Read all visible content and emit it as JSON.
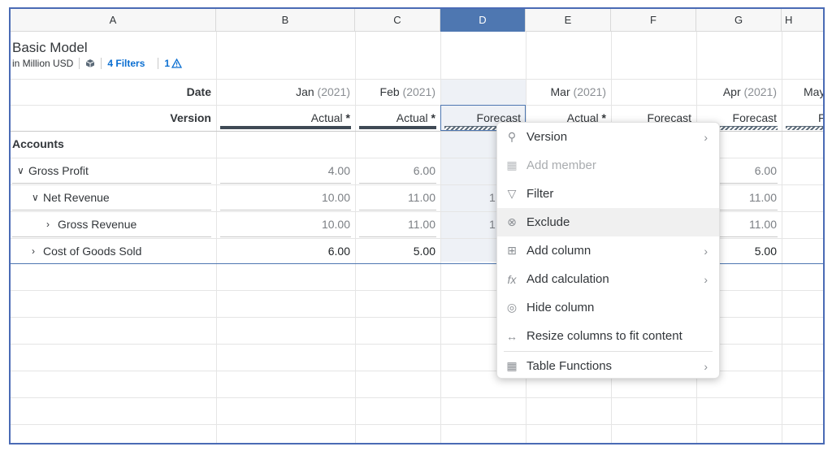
{
  "columns": [
    {
      "letter": "A"
    },
    {
      "letter": "B"
    },
    {
      "letter": "C"
    },
    {
      "letter": "D"
    },
    {
      "letter": "E"
    },
    {
      "letter": "F"
    },
    {
      "letter": "G"
    },
    {
      "letter": "H"
    }
  ],
  "header": {
    "title": "Basic Model",
    "unit": "in Million USD",
    "filters": "4 Filters",
    "warnings": "1"
  },
  "rows": {
    "date_label": "Date",
    "version_label": "Version",
    "accounts_label": "Accounts"
  },
  "dates": [
    {
      "month": "Jan",
      "year": "(2021)"
    },
    {
      "month": "Feb",
      "year": "(2021)"
    },
    {
      "month": "Mar",
      "year": "(2021)"
    },
    {
      "month": "Apr",
      "year": "(2021)"
    },
    {
      "month": "May",
      "year": ""
    }
  ],
  "versions": {
    "b": "Actual",
    "c": "Actual",
    "d": "Forecast",
    "e": "Actual",
    "f": "Forecast",
    "g": "Forecast",
    "h": "F",
    "star": "*"
  },
  "accounts": [
    {
      "label": "Gross Profit",
      "chev": "∨",
      "b": "4.00",
      "c": "6.00",
      "d": "",
      "g": "6.00"
    },
    {
      "label": "Net Revenue",
      "chev": "∨",
      "b": "10.00",
      "c": "11.00",
      "d": "1",
      "g": "11.00"
    },
    {
      "label": "Gross Revenue",
      "chev": "›",
      "b": "10.00",
      "c": "11.00",
      "d": "1",
      "g": "11.00"
    },
    {
      "label": "Cost of Goods Sold",
      "chev": "›",
      "b": "6.00",
      "c": "5.00",
      "d": "",
      "g": "5.00"
    }
  ],
  "menu": {
    "items": [
      {
        "label": "Version",
        "icon": "⚲"
      },
      {
        "label": "Add member",
        "icon": "▦"
      },
      {
        "label": "Filter",
        "icon": "▽"
      },
      {
        "label": "Exclude",
        "icon": "⊗"
      },
      {
        "label": "Add column",
        "icon": "⊞"
      },
      {
        "label": "Add calculation",
        "icon": "fx"
      },
      {
        "label": "Hide column",
        "icon": "◎"
      },
      {
        "label": "Resize columns to fit content",
        "icon": "↔"
      },
      {
        "label": "Table Functions",
        "icon": "▦"
      }
    ],
    "submenu_arrow": "›"
  }
}
